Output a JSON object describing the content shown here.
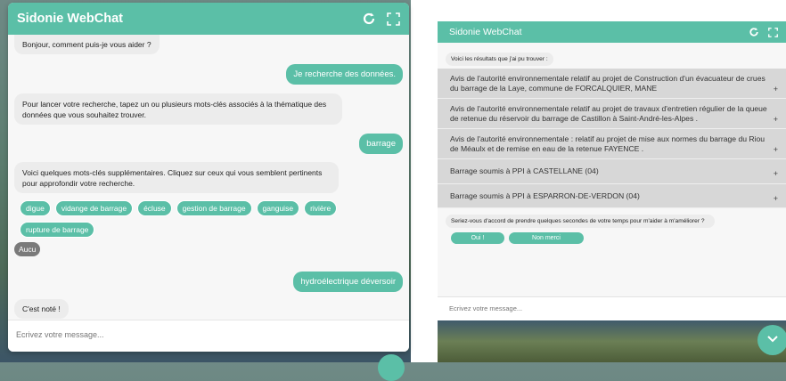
{
  "left": {
    "title": "Sidonie WebChat",
    "messages": {
      "greeting": "Bonjour, comment puis-je vous aider ?",
      "user1": "Je recherche des données.",
      "bot1": "Pour lancer votre recherche, tapez un ou plusieurs mots-clés associés à la thématique des données que vous souhaitez trouver.",
      "user2": "barrage",
      "bot2": "Voici quelques mots-clés supplémentaires. Cliquez sur ceux qui vous semblent pertinents pour approfondir votre recherche.",
      "chips": [
        "digue",
        "vidange de barrage",
        "écluse",
        "gestion de barrage",
        "ganguise",
        "rivière",
        "rupture de barrage"
      ],
      "aucun": "Aucu",
      "user3": "hydroélectrique déversoir",
      "bot3": "C'est noté !"
    },
    "input_placeholder": "Ecrivez votre message..."
  },
  "right": {
    "title": "Sidonie WebChat",
    "results_intro": "Voici les résultats que j'ai pu trouver :",
    "results": [
      "Avis de l'autorité environnementale relatif au projet de Construction d'un évacuateur de crues du barrage de la Laye, commune de FORCALQUIER, MANE",
      "Avis de l'autorité environnementale relatif au projet de travaux d'entretien régulier de la queue de retenue du réservoir du barrage de Castillon à Saint-André-les-Alpes .",
      "Avis de l'autorité environnementale : relatif au projet de mise aux normes du barrage du Riou de Méaulx et de remise en eau de la retenue FAYENCE .",
      "Barrage soumis à PPI à CASTELLANE (04)",
      "Barrage soumis à PPI à ESPARRON-DE-VERDON (04)"
    ],
    "plus": "+",
    "survey": "Seriez-vous d'accord de prendre quelques secondes de votre temps pour m'aider à m'améliorer ?",
    "yes": "Oui !",
    "no": "Non merci",
    "input_placeholder": "Ecrivez votre message..."
  },
  "colors": {
    "accent": "#5bbfa7",
    "bot_bubble": "#ececec",
    "result_bg": "#d7d7d7"
  },
  "icons": [
    "refresh-icon",
    "fullscreen-icon",
    "chevron-down-icon"
  ]
}
